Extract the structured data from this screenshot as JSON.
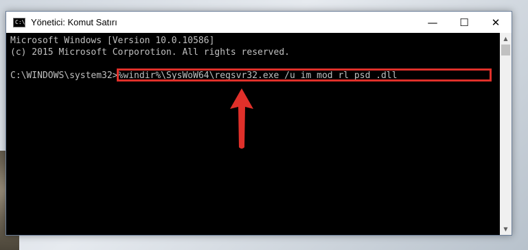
{
  "window": {
    "title": "Yönetici: Komut Satırı",
    "icon_text": "C:\\"
  },
  "controls": {
    "minimize": "—",
    "maximize": "☐",
    "close": "✕"
  },
  "console": {
    "line1": "Microsoft Windows [Version 10.0.10586]",
    "line2": "(c) 2015 Microsoft Corporotion. All rights reserved.",
    "prompt": "C:\\WINDOWS\\system32>",
    "command": "%windir%\\SysWoW64\\regsvr32.exe /u im_mod_rl_psd_.dll"
  },
  "scrollbar": {
    "up": "▲",
    "down": "▼"
  },
  "annotation": {
    "arrow_color": "#e0302a",
    "highlight_color": "#e0302a"
  }
}
